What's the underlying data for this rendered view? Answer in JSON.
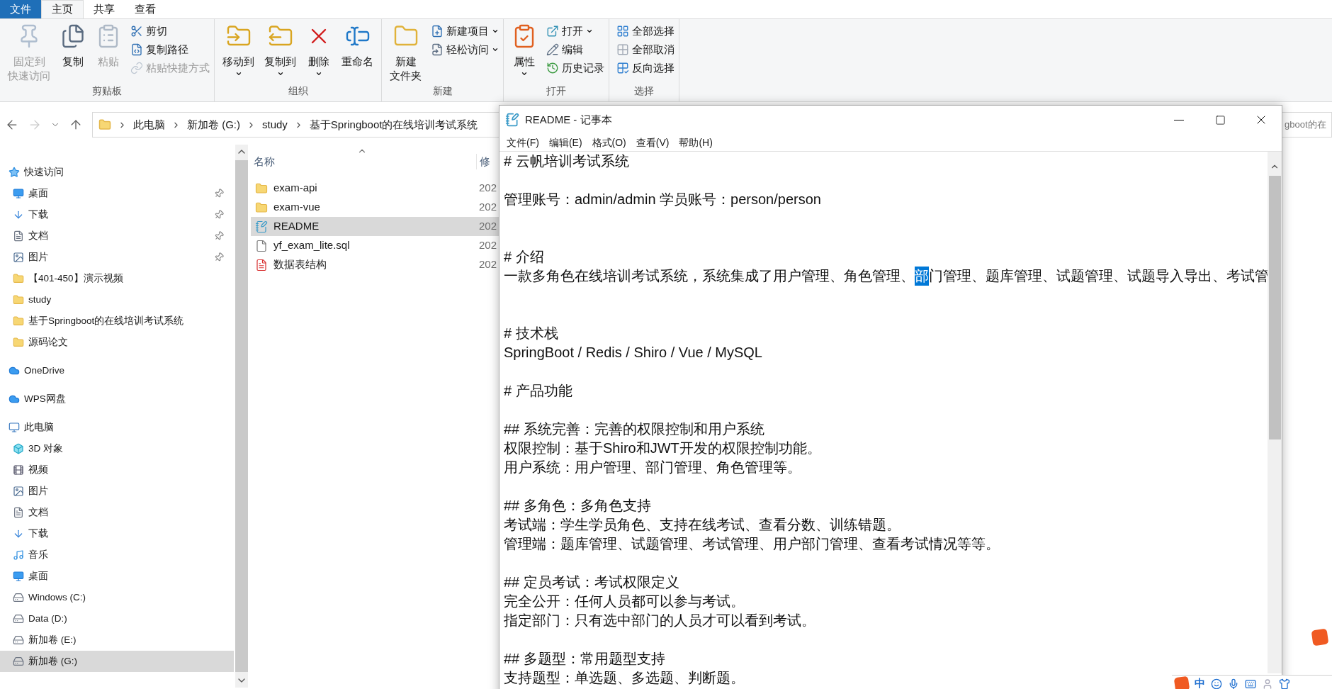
{
  "explorer": {
    "ribbon_tabs": [
      {
        "label": "文件",
        "kind": "file",
        "selected": false
      },
      {
        "label": "主页",
        "kind": "tab",
        "selected": true
      },
      {
        "label": "共享",
        "kind": "tab",
        "selected": false
      },
      {
        "label": "查看",
        "kind": "tab",
        "selected": false
      }
    ],
    "ribbon_groups": [
      {
        "label": "剪贴板",
        "buttons": [
          {
            "kind": "large",
            "lines": [
              "固定到",
              "快速访问"
            ],
            "disabled": true,
            "dropdown": false
          },
          {
            "kind": "large",
            "lines": [
              "复制"
            ],
            "disabled": false,
            "dropdown": false
          },
          {
            "kind": "large",
            "lines": [
              "粘贴"
            ],
            "disabled": true,
            "dropdown": false
          },
          {
            "kind": "small",
            "lines": [
              "剪切"
            ],
            "disabled": false,
            "dropdown": false
          },
          {
            "kind": "small",
            "lines": [
              "复制路径"
            ],
            "disabled": false,
            "dropdown": false
          },
          {
            "kind": "small",
            "lines": [
              "粘贴快捷方式"
            ],
            "disabled": true,
            "dropdown": false
          }
        ]
      },
      {
        "label": "组织",
        "buttons": [
          {
            "kind": "large",
            "lines": [
              "移动到"
            ],
            "disabled": false,
            "dropdown": true
          },
          {
            "kind": "large",
            "lines": [
              "复制到"
            ],
            "disabled": false,
            "dropdown": true
          },
          {
            "kind": "large",
            "lines": [
              "删除"
            ],
            "disabled": false,
            "dropdown": true
          },
          {
            "kind": "large",
            "lines": [
              "重命名"
            ],
            "disabled": false,
            "dropdown": false
          }
        ]
      },
      {
        "label": "新建",
        "buttons": [
          {
            "kind": "large",
            "lines": [
              "新建",
              "文件夹"
            ],
            "disabled": false,
            "dropdown": false
          },
          {
            "kind": "small",
            "lines": [
              "新建项目"
            ],
            "disabled": false,
            "dropdown": true
          },
          {
            "kind": "small",
            "lines": [
              "轻松访问"
            ],
            "disabled": false,
            "dropdown": true
          }
        ]
      },
      {
        "label": "打开",
        "buttons": [
          {
            "kind": "large",
            "lines": [
              "属性"
            ],
            "disabled": false,
            "dropdown": true
          },
          {
            "kind": "small",
            "lines": [
              "打开"
            ],
            "disabled": false,
            "dropdown": true
          },
          {
            "kind": "small",
            "lines": [
              "编辑"
            ],
            "disabled": false,
            "dropdown": false
          },
          {
            "kind": "small",
            "lines": [
              "历史记录"
            ],
            "disabled": false,
            "dropdown": false
          }
        ]
      },
      {
        "label": "选择",
        "buttons": [
          {
            "kind": "small",
            "lines": [
              "全部选择"
            ],
            "disabled": false,
            "dropdown": false
          },
          {
            "kind": "small",
            "lines": [
              "全部取消"
            ],
            "disabled": false,
            "dropdown": false
          },
          {
            "kind": "small",
            "lines": [
              "反向选择"
            ],
            "disabled": false,
            "dropdown": false
          }
        ]
      }
    ],
    "nav_buttons": [
      {
        "kind": "back",
        "disabled": false
      },
      {
        "kind": "forward",
        "disabled": true
      },
      {
        "kind": "recent",
        "disabled": false
      },
      {
        "kind": "up",
        "disabled": false
      }
    ],
    "breadcrumbs": [
      "此电脑",
      "新加卷 (G:)",
      "study",
      "基于Springboot的在线培训考试系统"
    ],
    "search_text": "gboot的在",
    "sidebar": [
      {
        "label": "快速访问",
        "kind": "star",
        "selected": false,
        "children": [
          {
            "label": "桌面",
            "kind": "desktop",
            "selected": false,
            "pinned": true
          },
          {
            "label": "下载",
            "kind": "downloads",
            "selected": false,
            "pinned": true
          },
          {
            "label": "文档",
            "kind": "documents",
            "selected": false,
            "pinned": true
          },
          {
            "label": "图片",
            "kind": "pictures",
            "selected": false,
            "pinned": true
          },
          {
            "label": "【401-450】演示视频",
            "kind": "folder",
            "selected": false,
            "pinned": false
          },
          {
            "label": "study",
            "kind": "folder",
            "selected": false,
            "pinned": false
          },
          {
            "label": "基于Springboot的在线培训考试系统",
            "kind": "folder",
            "selected": false,
            "pinned": false
          },
          {
            "label": "源码论文",
            "kind": "folder",
            "selected": false,
            "pinned": false
          }
        ]
      },
      {
        "label": "OneDrive",
        "kind": "cloud",
        "selected": false
      },
      {
        "label": "WPS网盘",
        "kind": "cloud",
        "selected": false
      },
      {
        "label": "此电脑",
        "kind": "computer",
        "selected": false,
        "children": [
          {
            "label": "3D 对象",
            "kind": "objects3d",
            "selected": false
          },
          {
            "label": "视频",
            "kind": "videos",
            "selected": false
          },
          {
            "label": "图片",
            "kind": "pictures",
            "selected": false
          },
          {
            "label": "文档",
            "kind": "documents",
            "selected": false
          },
          {
            "label": "下载",
            "kind": "downloads",
            "selected": false
          },
          {
            "label": "音乐",
            "kind": "music",
            "selected": false
          },
          {
            "label": "桌面",
            "kind": "desktop",
            "selected": false
          },
          {
            "label": "Windows (C:)",
            "kind": "drive",
            "selected": false
          },
          {
            "label": "Data (D:)",
            "kind": "drive",
            "selected": false
          },
          {
            "label": "新加卷 (E:)",
            "kind": "drive",
            "selected": false
          },
          {
            "label": "新加卷 (G:)",
            "kind": "drive",
            "selected": true
          }
        ]
      }
    ],
    "columns": [
      "名称",
      "修"
    ],
    "files": [
      {
        "name": "exam-api",
        "kind": "folder",
        "modified": "202",
        "selected": false
      },
      {
        "name": "exam-vue",
        "kind": "folder",
        "modified": "202",
        "selected": false
      },
      {
        "name": "README",
        "kind": "notepad",
        "modified": "202",
        "selected": true
      },
      {
        "name": "yf_exam_lite.sql",
        "kind": "file",
        "modified": "202",
        "selected": false
      },
      {
        "name": "数据表结构",
        "kind": "pdf",
        "modified": "202",
        "selected": false
      }
    ]
  },
  "notepad": {
    "title": "README - 记事本",
    "menu": [
      "文件(F)",
      "编辑(E)",
      "格式(O)",
      "查看(V)",
      "帮助(H)"
    ],
    "lines": [
      {
        "kind": "text",
        "segments": [
          {
            "text": "# 云帆培训考试系统",
            "selected": false
          }
        ]
      },
      {
        "kind": "blank"
      },
      {
        "kind": "text",
        "segments": [
          {
            "text": "管理账号：admin/admin 学员账号：person/person",
            "selected": false
          }
        ]
      },
      {
        "kind": "blank"
      },
      {
        "kind": "blank"
      },
      {
        "kind": "text",
        "segments": [
          {
            "text": "# 介绍",
            "selected": false
          }
        ]
      },
      {
        "kind": "text",
        "segments": [
          {
            "text": "一款多角色在线培训考试系统，系统集成了用户管理、角色管理、",
            "selected": false
          },
          {
            "text": "部",
            "selected": true
          },
          {
            "text": "门管理、题库管理、试题管理、试题导入导出、考试管",
            "selected": false
          }
        ]
      },
      {
        "kind": "blank"
      },
      {
        "kind": "blank"
      },
      {
        "kind": "text",
        "segments": [
          {
            "text": "# 技术栈",
            "selected": false
          }
        ]
      },
      {
        "kind": "text",
        "segments": [
          {
            "text": "SpringBoot / Redis / Shiro / Vue / MySQL",
            "selected": false
          }
        ]
      },
      {
        "kind": "blank"
      },
      {
        "kind": "text",
        "segments": [
          {
            "text": "# 产品功能",
            "selected": false
          }
        ]
      },
      {
        "kind": "blank"
      },
      {
        "kind": "text",
        "segments": [
          {
            "text": "## 系统完善：完善的权限控制和用户系统",
            "selected": false
          }
        ]
      },
      {
        "kind": "text",
        "segments": [
          {
            "text": "权限控制：基于Shiro和JWT开发的权限控制功能。",
            "selected": false
          }
        ]
      },
      {
        "kind": "text",
        "segments": [
          {
            "text": "用户系统：用户管理、部门管理、角色管理等。",
            "selected": false
          }
        ]
      },
      {
        "kind": "blank"
      },
      {
        "kind": "text",
        "segments": [
          {
            "text": "## 多角色：多角色支持",
            "selected": false
          }
        ]
      },
      {
        "kind": "text",
        "segments": [
          {
            "text": "考试端：学生学员角色、支持在线考试、查看分数、训练错题。",
            "selected": false
          }
        ]
      },
      {
        "kind": "text",
        "segments": [
          {
            "text": "管理端：题库管理、试题管理、考试管理、用户部门管理、查看考试情况等等。",
            "selected": false
          }
        ]
      },
      {
        "kind": "blank"
      },
      {
        "kind": "text",
        "segments": [
          {
            "text": "## 定员考试：考试权限定义",
            "selected": false
          }
        ]
      },
      {
        "kind": "text",
        "segments": [
          {
            "text": "完全公开：任何人员都可以参与考试。",
            "selected": false
          }
        ]
      },
      {
        "kind": "text",
        "segments": [
          {
            "text": "指定部门：只有选中部门的人员才可以看到考试。",
            "selected": false
          }
        ]
      },
      {
        "kind": "blank"
      },
      {
        "kind": "text",
        "segments": [
          {
            "text": "## 多题型：常用题型支持",
            "selected": false
          }
        ]
      },
      {
        "kind": "text",
        "segments": [
          {
            "text": "支持题型：单选题、多选题、判断题。",
            "selected": false
          }
        ]
      }
    ]
  },
  "ime_bar": {
    "mode": "中"
  }
}
